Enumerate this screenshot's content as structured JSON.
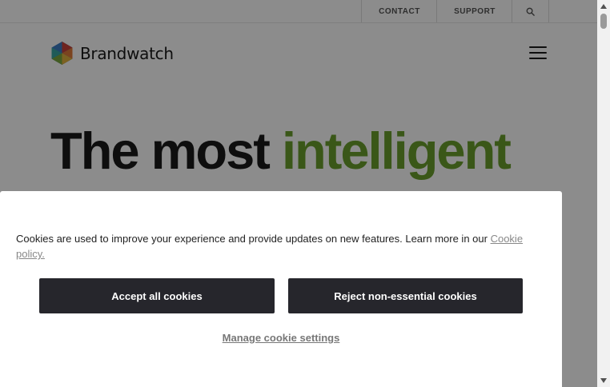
{
  "utility_nav": {
    "contact_label": "CONTACT",
    "support_label": "SUPPORT",
    "search_icon": "search-icon"
  },
  "header": {
    "brand_name": "Brandwatch",
    "menu_icon": "hamburger-menu-icon"
  },
  "hero": {
    "title_part1": "The most ",
    "title_accent": "intelligent"
  },
  "cookie_banner": {
    "message": "Cookies are used to improve your experience and provide updates on new features. Learn more in our ",
    "policy_link": "Cookie policy.",
    "accept_label": "Accept all cookies",
    "reject_label": "Reject non-essential cookies",
    "manage_label": "Manage cookie settings"
  },
  "colors": {
    "accent": "#6a9f2d",
    "button_bg": "#26262c",
    "text": "#1a1a1a"
  }
}
